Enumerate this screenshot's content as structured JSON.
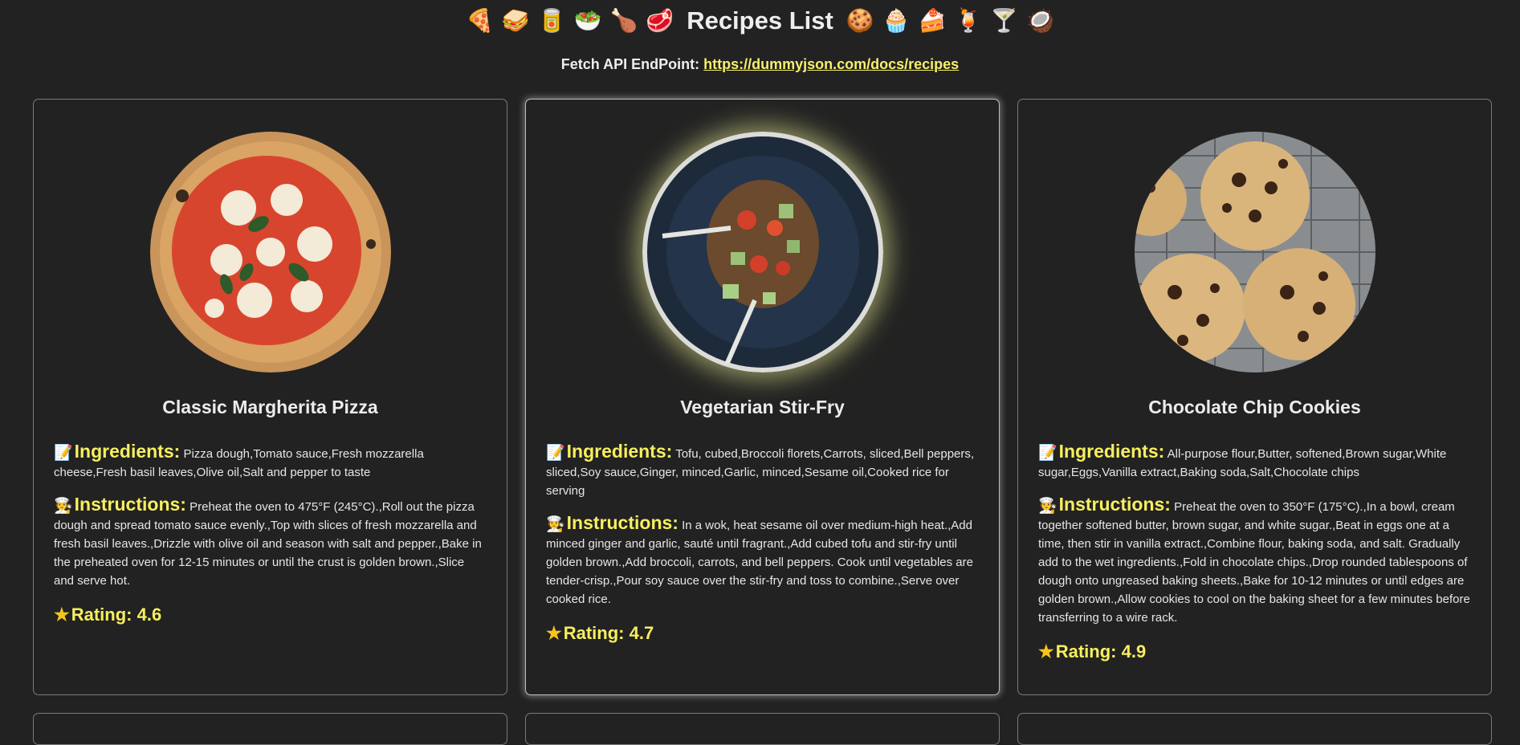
{
  "header": {
    "title": "Recipes List",
    "emojis_left": [
      "🍕",
      "🥪",
      "🥫",
      "🥗",
      "🍗",
      "🥩"
    ],
    "emojis_right": [
      "🍪",
      "🧁",
      "🍰",
      "🍹",
      "🍸",
      "🥥"
    ],
    "endpoint_label": "Fetch API EndPoint:",
    "endpoint_url": "https://dummyjson.com/docs/recipes"
  },
  "labels": {
    "ingredients": "Ingredients:",
    "instructions": "Instructions:",
    "ingredients_icon": "📝",
    "instructions_icon": "🧑‍🍳"
  },
  "recipes": [
    {
      "name": "Classic Margherita Pizza",
      "image_icon": "pizza-image",
      "ingredients": "Pizza dough,Tomato sauce,Fresh mozzarella cheese,Fresh basil leaves,Olive oil,Salt and pepper to taste",
      "instructions": "Preheat the oven to 475°F (245°C).,Roll out the pizza dough and spread tomato sauce evenly.,Top with slices of fresh mozzarella and fresh basil leaves.,Drizzle with olive oil and season with salt and pepper.,Bake in the preheated oven for 12-15 minutes or until the crust is golden brown.,Slice and serve hot.",
      "rating": "Rating: 4.6"
    },
    {
      "name": "Vegetarian Stir-Fry",
      "image_icon": "stir-fry-image",
      "ingredients": "Tofu, cubed,Broccoli florets,Carrots, sliced,Bell peppers, sliced,Soy sauce,Ginger, minced,Garlic, minced,Sesame oil,Cooked rice for serving",
      "instructions": "In a wok, heat sesame oil over medium-high heat.,Add minced ginger and garlic, sauté until fragrant.,Add cubed tofu and stir-fry until golden brown.,Add broccoli, carrots, and bell peppers. Cook until vegetables are tender-crisp.,Pour soy sauce over the stir-fry and toss to combine.,Serve over cooked rice.",
      "rating": "Rating: 4.7"
    },
    {
      "name": "Chocolate Chip Cookies",
      "image_icon": "cookies-image",
      "ingredients": "All-purpose flour,Butter, softened,Brown sugar,White sugar,Eggs,Vanilla extract,Baking soda,Salt,Chocolate chips",
      "instructions": "Preheat the oven to 350°F (175°C).,In a bowl, cream together softened butter, brown sugar, and white sugar.,Beat in eggs one at a time, then stir in vanilla extract.,Combine flour, baking soda, and salt. Gradually add to the wet ingredients.,Fold in chocolate chips.,Drop rounded tablespoons of dough onto ungreased baking sheets.,Bake for 10-12 minutes or until edges are golden brown.,Allow cookies to cool on the baking sheet for a few minutes before transferring to a wire rack.",
      "rating": "Rating: 4.9"
    }
  ],
  "colors": {
    "background": "#222222",
    "accent": "#f7ef5e",
    "link": "#f7ef6a",
    "card_border": "#7a7a7a"
  }
}
